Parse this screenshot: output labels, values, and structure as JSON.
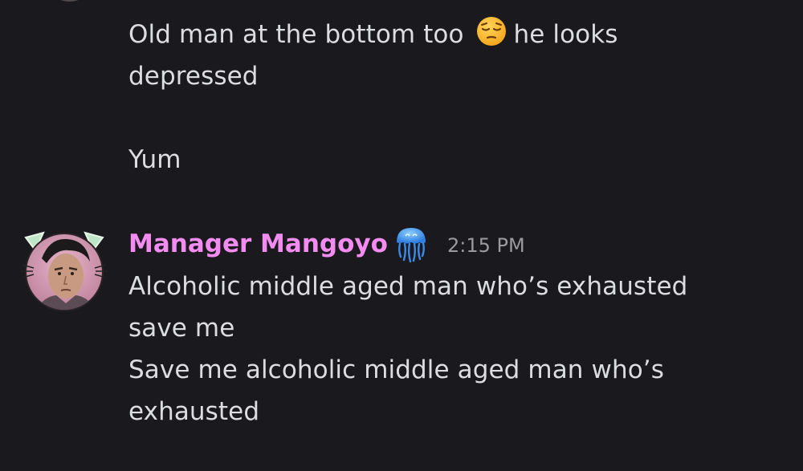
{
  "colors": {
    "background": "#1a1a1e",
    "text": "#dcdde1",
    "username": "#f38cf0",
    "timestamp": "#9a9ba1"
  },
  "previous_messages": {
    "line1_before": "Old man at the bottom too",
    "emoji": "pensive-face",
    "line1_after": "he looks",
    "line2": "depressed",
    "line3": "Yum"
  },
  "message_group": {
    "author": "Manager Mangoyo",
    "author_badge": "jellyfish-icon",
    "timestamp": "2:15 PM",
    "lines": [
      "Alcoholic middle aged man who’s exhausted",
      "save me",
      "Save me alcoholic middle aged man who’s",
      "exhausted"
    ]
  }
}
